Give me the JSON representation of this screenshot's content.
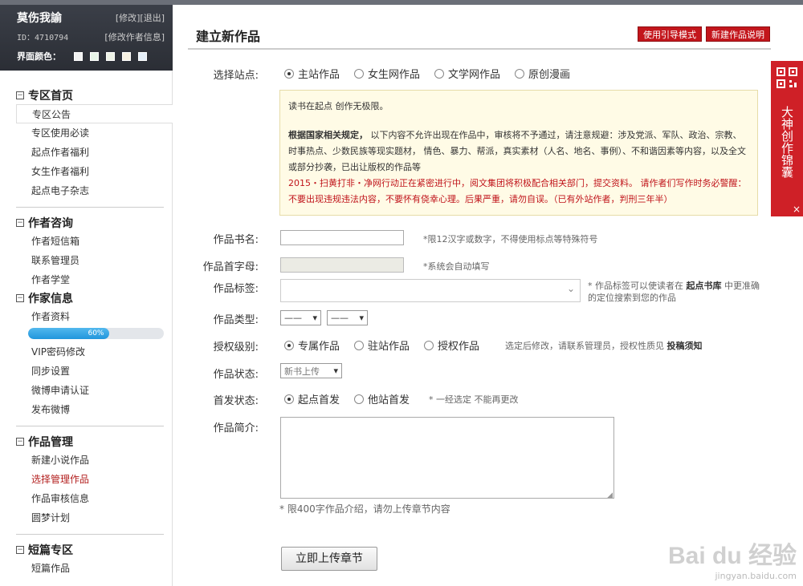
{
  "user": {
    "name": "莫伤我諭",
    "links": "[修改][退出]",
    "id": "ID：4710794",
    "edit_info": "[修改作者信息]",
    "theme_label": "界面颜色：",
    "swatches": [
      "#f2f2f2",
      "#e8f4e8",
      "#eef3e6",
      "#f7f1e2",
      "#e4eef8"
    ]
  },
  "sidebar": {
    "sections": [
      {
        "title": "专区首页",
        "items": [
          "专区公告",
          "专区使用必读",
          "起点作者福利",
          "女生作者福利",
          "起点电子杂志"
        ]
      },
      {
        "title": "作者咨询",
        "items": [
          "作者短信箱",
          "联系管理员",
          "作者学堂"
        ]
      },
      {
        "title": "作家信息",
        "items_a": [
          "作者资料"
        ],
        "progress_text": "60%",
        "progress": 0.6,
        "items_b": [
          "VIP密码修改",
          "同步设置",
          "微博申请认证",
          "发布微博"
        ]
      },
      {
        "title": "作品管理",
        "items": [
          "新建小说作品",
          "选择管理作品",
          "作品审核信息",
          "圆梦计划"
        ]
      },
      {
        "title": "短篇专区",
        "items": [
          "短篇作品"
        ]
      }
    ]
  },
  "main": {
    "title": "建立新作品",
    "btn_guide": "使用引导模式",
    "btn_help": "新建作品说明",
    "site_label": "选择站点:",
    "sites": [
      "主站作品",
      "女生网作品",
      "文学网作品",
      "原创漫画"
    ],
    "notice": {
      "line1": "读书在起点 创作无极限。",
      "bold": "根据国家相关规定，",
      "body": "以下内容不允许出现在作品中，审核将不予通过，请注意规避：涉及党派、军队、政治、宗教、时事热点、少数民族等现实题材， 情色、暴力、帮派，真实素材（人名、地名、事例）、不和谐因素等内容，以及全文或部分抄袭，已出让版权的作品等",
      "red": "2015・扫黄打非・净网行动正在紧密进行中，阅文集团将积极配合相关部门，提交资料。 请作者们写作时务必警醒：不要出现违规违法内容，不要怀有侥幸心理。后果严重，请勿自误。（已有外站作者，判刑三年半）"
    },
    "book_name_label": "作品书名:",
    "book_name_hint": "*限12汉字或数字，不得使用标点等特殊符号",
    "initial_label": "作品首字母:",
    "initial_hint": "*系统会自动填写",
    "tags_label": "作品标签:",
    "tags_hint_a": "* 作品标签可以使读者在",
    "tags_hint_b": "起点书库",
    "tags_hint_c": "中更准确的定位搜索到您的作品",
    "type_label": "作品类型:",
    "type_select1": "——",
    "type_select2": "——",
    "auth_label": "授权级别:",
    "auth_options": [
      "专属作品",
      "驻站作品",
      "授权作品"
    ],
    "auth_hint": "选定后修改，请联系管理员，授权性质见",
    "auth_link": "投稿须知",
    "status_label": "作品状态:",
    "status_value": "新书上传",
    "first_label": "首发状态:",
    "first_options": [
      "起点首发",
      "他站首发"
    ],
    "first_hint": "* 一经选定 不能再更改",
    "intro_label": "作品简介:",
    "intro_hint": "* 限400字作品介绍，请勿上传章节内容",
    "submit": "立即上传章节"
  },
  "float": {
    "text": "大神创作锦囊",
    "close": "×"
  },
  "watermark": {
    "logo": "Bai du 经验",
    "url": "jingyan.baidu.com"
  }
}
